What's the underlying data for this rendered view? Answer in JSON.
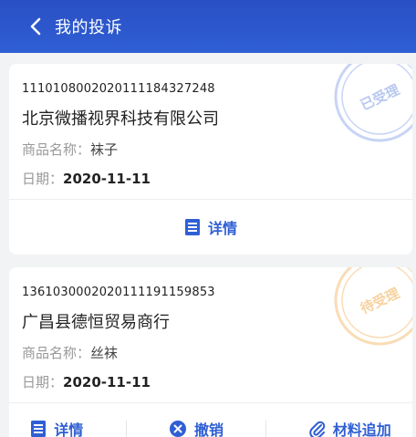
{
  "header": {
    "title": "我的投诉"
  },
  "complaints": [
    {
      "number": "1110108002020111184327248",
      "company": "北京微播视界科技有限公司",
      "product_label": "商品名称：",
      "product": "袜子",
      "date_label": "日期：",
      "date": "2020-11-11",
      "stamp": "已受理",
      "stamp_color": "#b8c8f0",
      "actions": {
        "detail": "详情"
      }
    },
    {
      "number": "1361030002020111191159853",
      "company": "广昌县德恒贸易商行",
      "product_label": "商品名称：",
      "product": "丝袜",
      "date_label": "日期：",
      "date": "2020-11-11",
      "stamp": "待受理",
      "stamp_color": "#f8d2a0",
      "actions": {
        "detail": "详情",
        "revoke": "撤销",
        "supplement": "材料追加"
      }
    }
  ],
  "colors": {
    "accent": "#2f5fd4",
    "header": "#2a4fc4"
  }
}
